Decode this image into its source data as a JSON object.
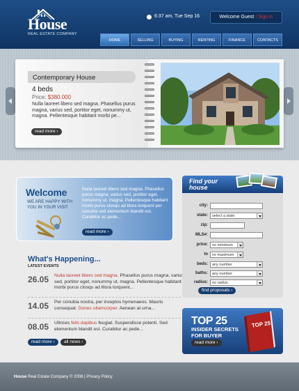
{
  "header": {
    "logo_title": "House",
    "logo_subtitle": "REAL ESTATE COMPANY",
    "datetime": "6:37 am, Tue Sep 16",
    "welcome_text": "Welcome Guest",
    "sign_in": "Sign in",
    "separator": "|"
  },
  "nav": {
    "items": [
      {
        "label": "HOME"
      },
      {
        "label": "SELLING"
      },
      {
        "label": "BUYING"
      },
      {
        "label": "RENTING"
      },
      {
        "label": "FINANCE"
      },
      {
        "label": "CONTACTS"
      }
    ],
    "active": "HOME"
  },
  "featured": {
    "title": "Contemporary House",
    "beds": "4 beds",
    "price_label": "Price:",
    "price": "$380.000",
    "description": "Nulla laoreet libero sed magna. Phasellus purus magna, varius sed, portitor eget, nonummy ut, magna. Pellentesque habitant morbi pe...",
    "read_more": "read more"
  },
  "welcome": {
    "title": "Welcome",
    "subtitle": "WE ARE HAPPY WITH YOU IN YOUR VISIT",
    "text": "Nulla laoreet libero sed magna. Phasellus purus magna, varius sed, portitor eget, nonummy ut, magna. Pellentesque habitant morbi purus closqu ad litora torquent per conubia sed elementum blandit est. Curabitur ac pede...",
    "read_more": "read more"
  },
  "events": {
    "title": "What's Happening...",
    "subtitle": "LATEST EVENTS",
    "items": [
      {
        "date": "26.05",
        "highlight": "Nulla laoreet libero sed magna.",
        "text": " Phasellus purus magna, varius sed, portitor eget, nonummy ut, magna. Pellentesque habitant morbi purus closqu ad litora torquent..."
      },
      {
        "date": "14.05",
        "text_before": "Per conubia nostra, per inceptos hymenaeos. Mauris consequat. ",
        "highlight": "Donec ullamcorper.",
        "text_after": " Aenean at urna..."
      },
      {
        "date": "08.05",
        "text_before": "Ultrices ",
        "highlight": "felis dapibus",
        "text_after": " feugiat. Suspendisse potenti. Sed elementum blandit est. Curabitur ac pede..."
      }
    ],
    "read_more": "read more",
    "all_news": "all news"
  },
  "find_house": {
    "title_line1": "Find your",
    "title_line2": "house",
    "fields": [
      {
        "label": "city:",
        "value": "",
        "type": "text"
      },
      {
        "label": "state:",
        "value": "select a state",
        "type": "select"
      },
      {
        "label": "zip:",
        "value": "",
        "type": "text"
      },
      {
        "label": "MLS#:",
        "value": "",
        "type": "text"
      },
      {
        "label": "price:",
        "value": "no minimum",
        "type": "select"
      },
      {
        "label": "to",
        "value": "no maximum",
        "type": "select"
      },
      {
        "label": "beds:",
        "value": "any number",
        "type": "select"
      },
      {
        "label": "baths:",
        "value": "any number",
        "type": "select"
      },
      {
        "label": "radius:",
        "value": "no radius",
        "type": "select"
      }
    ],
    "submit": "find proposals"
  },
  "promo": {
    "title": "TOP 25",
    "line1": "INSIDER SECRETS",
    "line2": "FOR BUYER",
    "read_more": "read more",
    "book_label": "TOP 25"
  },
  "footer": {
    "brand": "House",
    "text": " Real Estate Company © 2008 | Privacy Policy"
  },
  "colors": {
    "header_blue": "#1e4d86",
    "accent_red": "#c0392b",
    "footer_gray": "#6f7983"
  }
}
